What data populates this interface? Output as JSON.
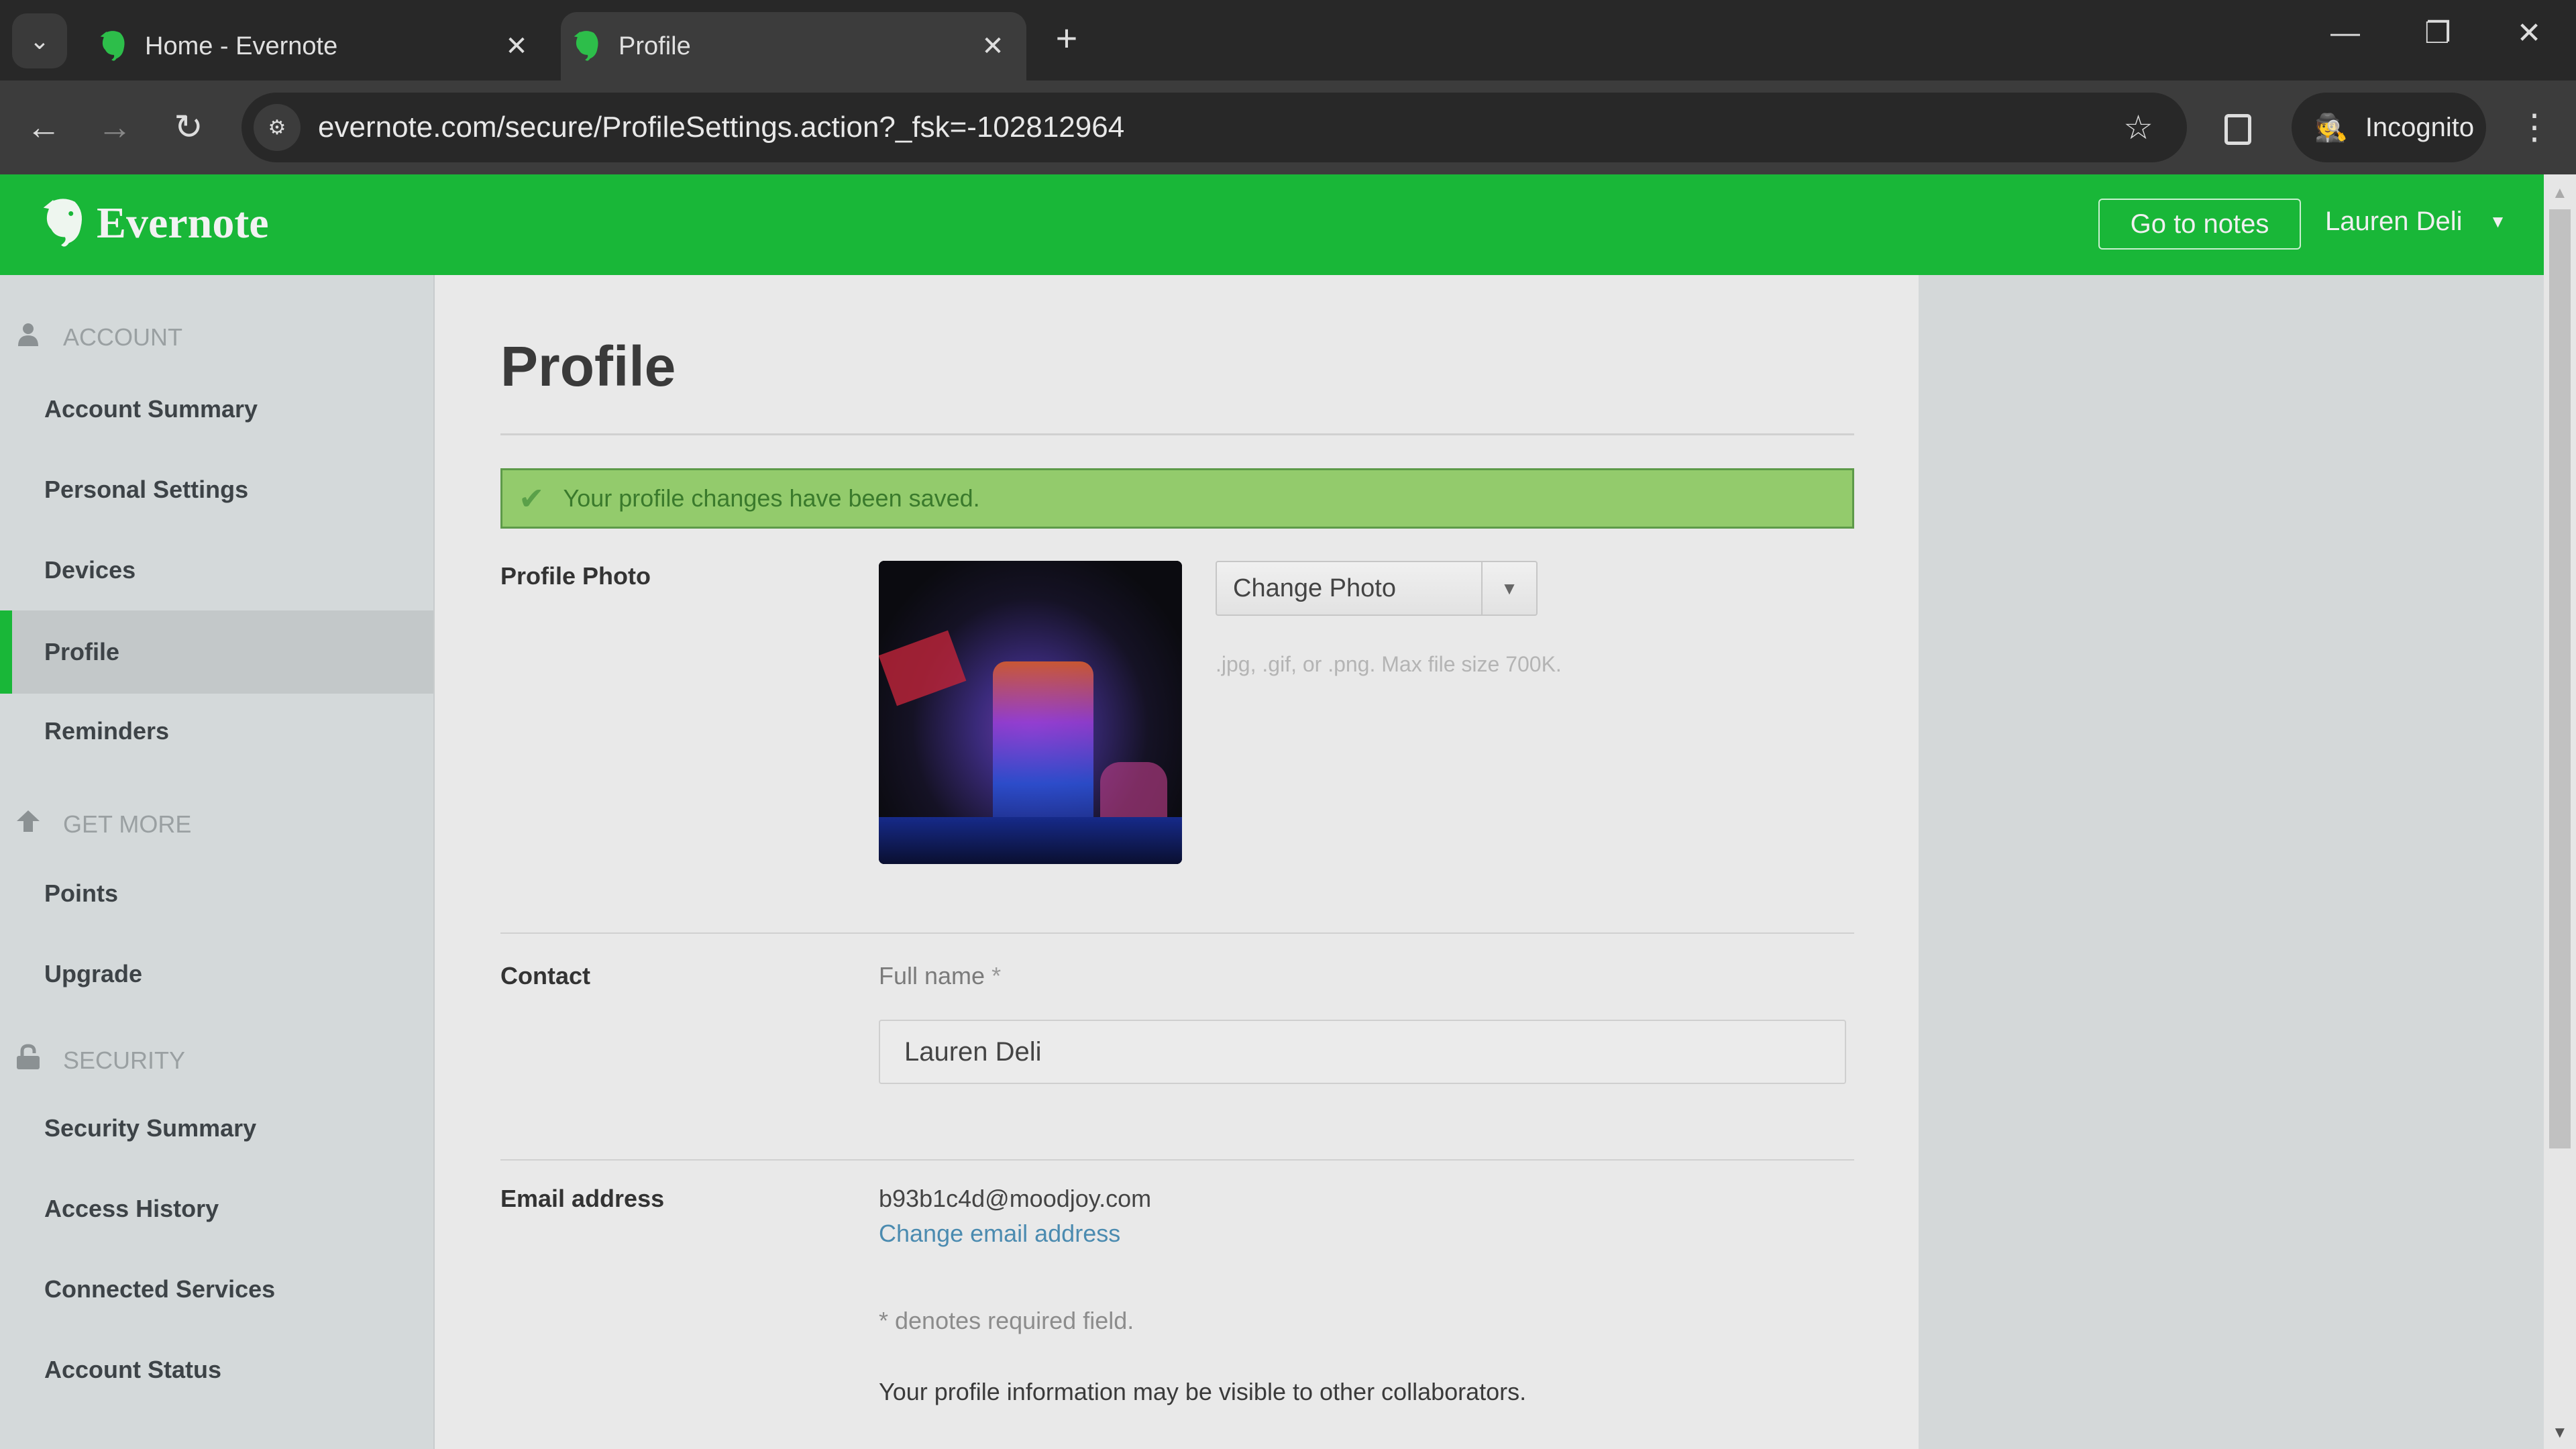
{
  "browser": {
    "tabs": [
      {
        "label": "Home - Evernote",
        "active": false
      },
      {
        "label": "Profile",
        "active": true
      }
    ],
    "url": "evernote.com/secure/ProfileSettings.action?_fsk=-102812964",
    "incognito_label": "Incognito",
    "icons": {
      "tab_menu": "⌄",
      "close": "✕",
      "new_tab": "+",
      "minimize": "—",
      "restore": "❐",
      "window_close": "✕",
      "back": "←",
      "forward": "→",
      "reload": "↻",
      "site_info": "⚙",
      "star": "☆",
      "incognito": "🕵",
      "menu": "⋮"
    }
  },
  "header": {
    "brand": "Evernote",
    "go_to_notes": "Go to notes",
    "user_name": "Lauren Deli",
    "caret": "▼",
    "brand_color": "#19b738"
  },
  "sidebar": {
    "sections": [
      {
        "title": "ACCOUNT",
        "icon": "user-icon",
        "items": [
          "Account Summary",
          "Personal Settings",
          "Devices",
          "Profile",
          "Reminders"
        ]
      },
      {
        "title": "GET MORE",
        "icon": "arrow-up-icon",
        "items": [
          "Points",
          "Upgrade"
        ]
      },
      {
        "title": "SECURITY",
        "icon": "lock-icon",
        "items": [
          "Security Summary",
          "Access History",
          "Connected Services",
          "Account Status"
        ]
      }
    ],
    "active_item": "Profile",
    "section_glyphs": {
      "account": "👤",
      "get_more": "⬆",
      "security": "🔒"
    }
  },
  "main": {
    "title": "Profile",
    "alert": {
      "icon": "✔",
      "message": "Your profile changes have been saved."
    },
    "profile_photo": {
      "label": "Profile Photo",
      "button_label": "Change Photo",
      "button_caret": "▼",
      "hint": ".jpg, .gif, or .png. Max file size 700K."
    },
    "contact": {
      "label": "Contact",
      "full_name_label": "Full name",
      "required_mark": "*",
      "full_name_value": "Lauren Deli"
    },
    "email": {
      "label": "Email address",
      "value": "b93b1c4d@moodjoy.com",
      "change_link": "Change email address"
    },
    "required_note": "* denotes required field.",
    "visibility_note": "Your profile information may be visible to other collaborators."
  },
  "scrollbar": {
    "up": "▲",
    "down": "▼"
  }
}
